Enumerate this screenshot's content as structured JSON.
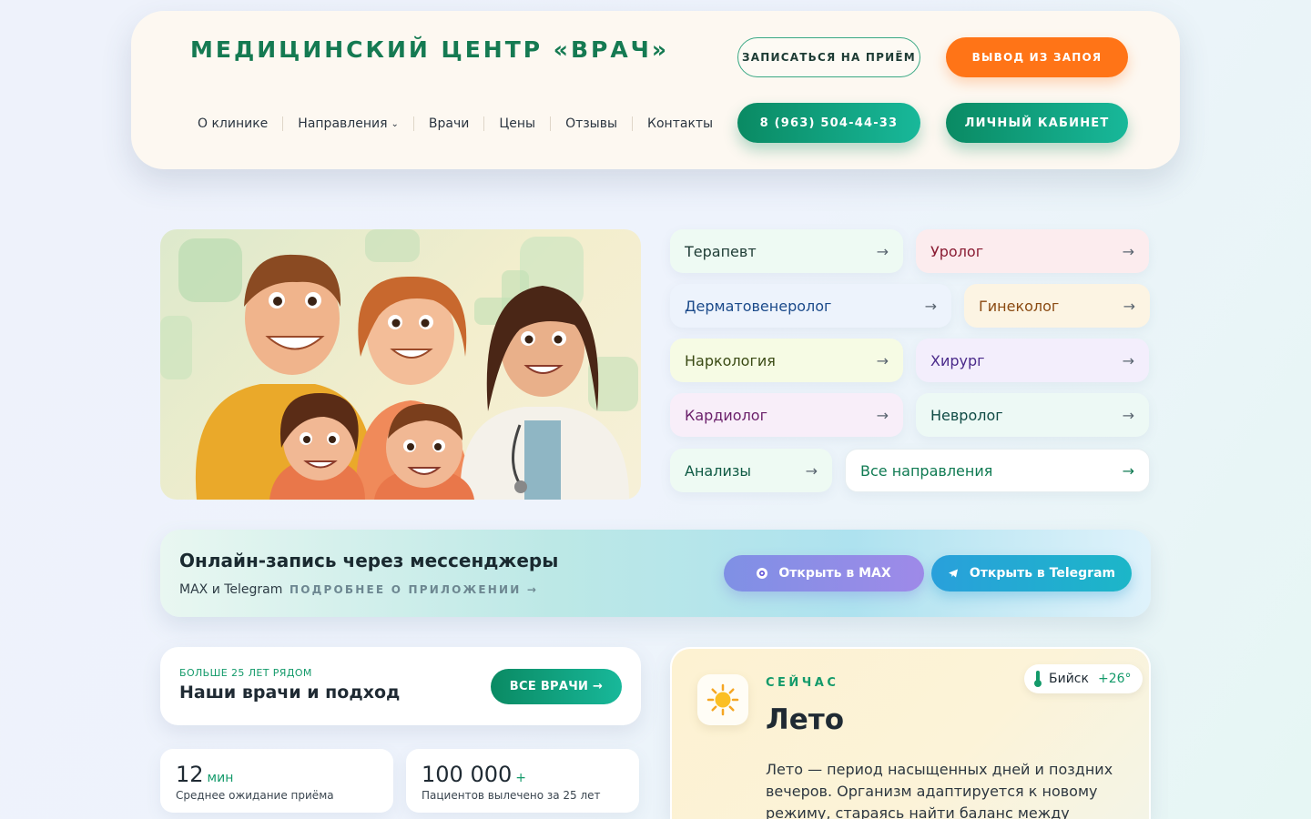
{
  "header": {
    "brand": "МЕДИЦИНСКИЙ ЦЕНТР «ВРАЧ»",
    "nav": [
      {
        "label": "О клинике"
      },
      {
        "label": "Направления"
      },
      {
        "label": "Врачи"
      },
      {
        "label": "Цены"
      },
      {
        "label": "Отзывы"
      },
      {
        "label": "Контакты"
      }
    ],
    "book_label": "ЗАПИСАТЬСЯ НА ПРИЁМ",
    "detox_label": "ВЫВОД ИЗ ЗАПОЯ",
    "phone_label": "8 (963) 504-44-33",
    "cabinet_label": "ЛИЧНЫЙ КАБИНЕТ"
  },
  "directions": [
    {
      "label": "Терапевт",
      "color": "#1d3b34"
    },
    {
      "label": "Уролог",
      "color": "#8a1c33"
    },
    {
      "label": "Дерматовенеролог",
      "color": "#1b4a8a"
    },
    {
      "label": "Гинеколог",
      "color": "#8a4a12"
    },
    {
      "label": "Наркология",
      "color": "#3a4a14"
    },
    {
      "label": "Хирург",
      "color": "#4a2a8a"
    },
    {
      "label": "Кардиолог",
      "color": "#6a1f6a"
    },
    {
      "label": "Невролог",
      "color": "#0f4a44"
    },
    {
      "label": "Анализы",
      "color": "#0f5a44"
    },
    {
      "label": "Все направления",
      "color": "#0f7a52"
    }
  ],
  "arrow": "→",
  "messengers": {
    "title": "Онлайн-запись через мессенджеры",
    "subtitle": "MAX и Telegram",
    "more": "ПОДРОБНЕЕ О ПРИЛОЖЕНИИ →",
    "max_label": "Открыть в MAX",
    "tg_label": "Открыть в Telegram"
  },
  "doctors": {
    "eyebrow": "БОЛЬШЕ 25 ЛЕТ РЯДОМ",
    "title": "Наши врачи и подход",
    "button": "ВСЕ ВРАЧИ →"
  },
  "stats": [
    {
      "value": "12",
      "unit": "мин",
      "label": "Среднее ожидание приёма"
    },
    {
      "value": "100 000",
      "unit": "+",
      "label": "Пациентов вылечено за 25 лет"
    }
  ],
  "season": {
    "eyebrow": "СЕЙЧАС",
    "title": "Лето",
    "text": "Лето — период насыщенных дней и поздних вечеров. Организм адаптируется к новому режиму, стараясь найти баланс между",
    "city": "Бийск",
    "temp": "+26°"
  },
  "colors": {
    "brand_green": "#157a52",
    "accent_orange": "#ff7417"
  }
}
